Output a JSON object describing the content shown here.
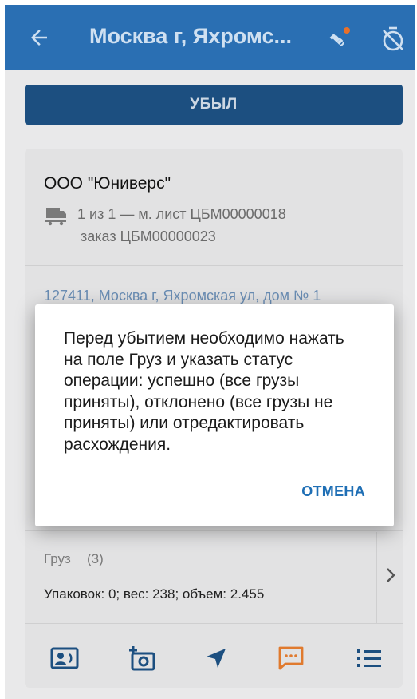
{
  "appbar": {
    "title": "Москва г, Яхромс...",
    "background": "#2a6fb3"
  },
  "main_button": {
    "label": "УБЫЛ"
  },
  "card": {
    "company": "ООО \"Юниверс\"",
    "route_line1": "1 из 1 —  м. лист ЦБМ00000018",
    "route_line2": "заказ ЦБМ00000023",
    "address": "127411, Москва г, Яхромская ул, дом № 1",
    "cargo": {
      "label": "Груз",
      "count": "(3)",
      "summary": "Упаковок: 0; вес: 238; объем: 2.455"
    }
  },
  "toolbar": {
    "icons": [
      "contact-card-icon",
      "add-photo-icon",
      "navigation-arrow-icon",
      "message-icon",
      "list-icon"
    ]
  },
  "dialog": {
    "message": "Перед убытием необходимо нажать на поле Груз и указать статус операции: успешно (все грузы приняты), отклонено (все грузы не приняты) или отредактировать расхождения.",
    "cancel_label": "ОТМЕНА"
  },
  "colors": {
    "accent": "#1f6fb5",
    "primary_dark": "#1c4f80",
    "message_icon": "#e07a2e",
    "satellite_dot": "#e8702a"
  }
}
